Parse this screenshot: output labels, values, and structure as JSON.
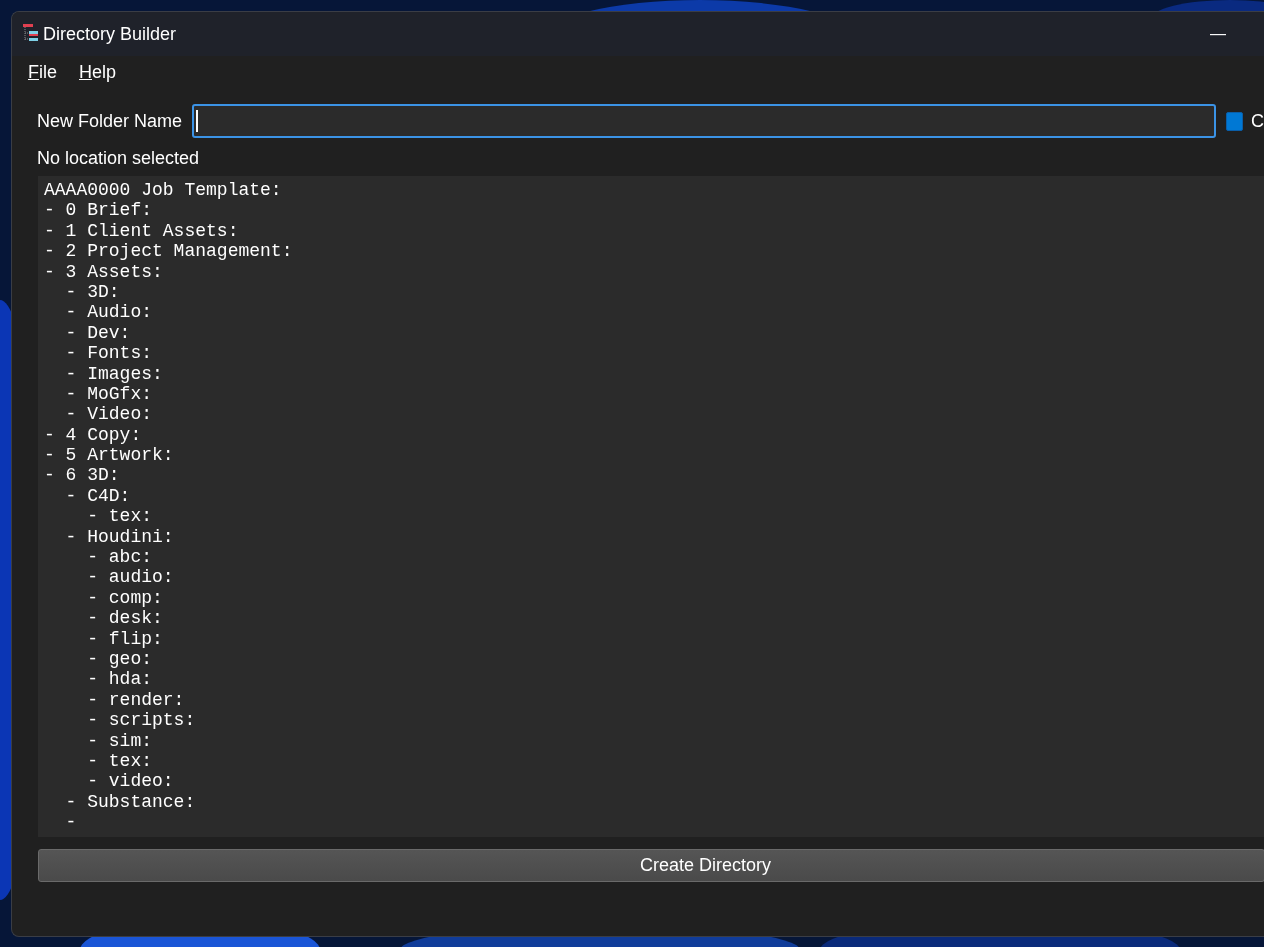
{
  "window": {
    "title": "Directory Builder",
    "controls": [
      "—"
    ]
  },
  "menu": [
    {
      "label": "File"
    },
    {
      "label": "Help"
    }
  ],
  "folder_name": {
    "label": "New Folder Name"
  },
  "checkbox": {
    "label": "C",
    "checked": true
  },
  "location": "No location selected",
  "template": {
    "text": "AAAA0000 Job Template:",
    "children": [
      {
        "text": "- 0 Brief:"
      },
      {
        "text": "- 1 Client Assets:"
      },
      {
        "text": "- 2 Project Management:"
      },
      {
        "text": "- 3 Assets:",
        "children": [
          {
            "text": "- 3D:"
          },
          {
            "text": "- Audio:"
          },
          {
            "text": "- Dev:"
          },
          {
            "text": "- Fonts:"
          },
          {
            "text": "- Images:"
          },
          {
            "text": "- MoGfx:"
          },
          {
            "text": "- Video:"
          }
        ]
      },
      {
        "text": "- 4 Copy:"
      },
      {
        "text": "- 5 Artwork:"
      },
      {
        "text": "- 6 3D:",
        "children": [
          {
            "text": "- C4D:",
            "children": [
              {
                "text": "- tex:"
              }
            ]
          },
          {
            "text": "- Houdini:",
            "children": [
              {
                "text": "- abc:"
              },
              {
                "text": "- audio:"
              },
              {
                "text": "- comp:"
              },
              {
                "text": "- desk:"
              },
              {
                "text": "- flip:"
              },
              {
                "text": "- geo:"
              },
              {
                "text": "- hda:"
              },
              {
                "text": "- render:"
              },
              {
                "text": "- scripts:"
              },
              {
                "text": "- sim:"
              },
              {
                "text": "- tex:"
              },
              {
                "text": "- video:"
              }
            ]
          },
          {
            "text": "- Substance:"
          },
          {
            "text": "-"
          }
        ]
      }
    ]
  },
  "create_button": "Create Directory"
}
